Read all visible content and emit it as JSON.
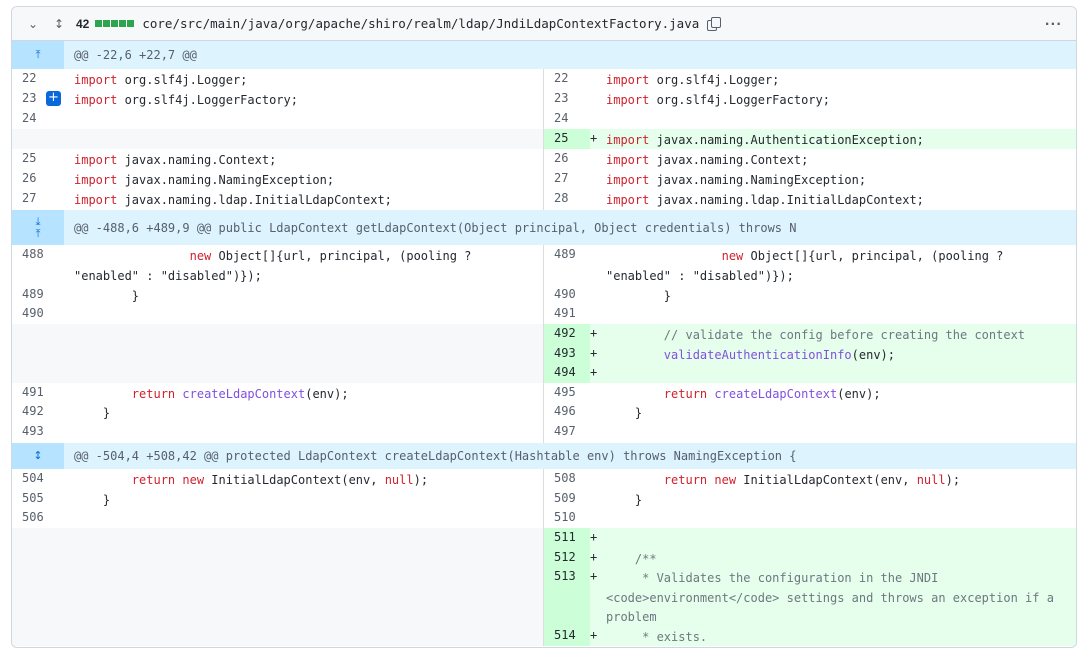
{
  "file": {
    "changes": "42",
    "path": "core/src/main/java/org/apache/shiro/realm/ldap/JndiLdapContextFactory.java",
    "collapse_icon": "chevron-down-icon",
    "expand_icon": "unfold-icon",
    "copy_icon": "copy-icon",
    "more_label": "···"
  },
  "hunks": [
    "@@ -22,6 +22,7 @@",
    "@@ -488,6 +489,9 @@ public LdapContext getLdapContext(Object principal, Object credentials) throws N",
    "@@ -504,4 +508,42 @@ protected LdapContext createLdapContext(Hashtable env) throws NamingException {"
  ],
  "lines": {
    "l22": "22",
    "l23": "23",
    "l24": "24",
    "l25": "25",
    "l26": "26",
    "l27": "27",
    "r22": "22",
    "r23": "23",
    "r24": "24",
    "r25": "25",
    "r26": "26",
    "r27": "27",
    "r28": "28",
    "import_kw": "import",
    "logger": " org.slf4j.Logger;",
    "loggerfactory": " org.slf4j.LoggerFactory;",
    "authexc": " javax.naming.AuthenticationException;",
    "context": " javax.naming.Context;",
    "namingexc": " javax.naming.NamingException;",
    "initialldap": " javax.naming.ldap.InitialLdapContext;",
    "l488": "488",
    "l489": "489",
    "l490": "490",
    "l491": "491",
    "l492": "492",
    "l493": "493",
    "r489": "489",
    "r490": "490",
    "r491": "491",
    "r492": "492",
    "r493": "493",
    "r494": "494",
    "r495": "495",
    "r496": "496",
    "r497": "497",
    "new_kw": "new",
    "new_obj_indent": "                ",
    "new_obj_rest": " Object[]{url, principal, (pooling ?\n\"enabled\" : \"disabled\")});",
    "close_brace_8": "        }",
    "comment_validate": "        // validate the config before creating the context",
    "validate_call_indent": "        ",
    "validate_fn": "validateAuthenticationInfo",
    "validate_rest": "(env);",
    "return_indent": "        ",
    "return_kw": "return",
    "create_fn": "createLdapContext",
    "create_rest": "(env);",
    "close_brace_4": "    }",
    "l504": "504",
    "l505": "505",
    "l506": "506",
    "r508": "508",
    "r509": "509",
    "r510": "510",
    "r511": "511",
    "r512": "512",
    "r513": "513",
    "r514": "514",
    "initial_rest": " InitialLdapContext(env, ",
    "null_kw": "null",
    "paren_end": ");",
    "javadoc_open": "    /**",
    "javadoc_line1": "     * Validates the configuration in the JNDI\n<code>environment</code> settings and throws an exception if a\nproblem",
    "javadoc_line2": "     * exists."
  },
  "plus": "+"
}
